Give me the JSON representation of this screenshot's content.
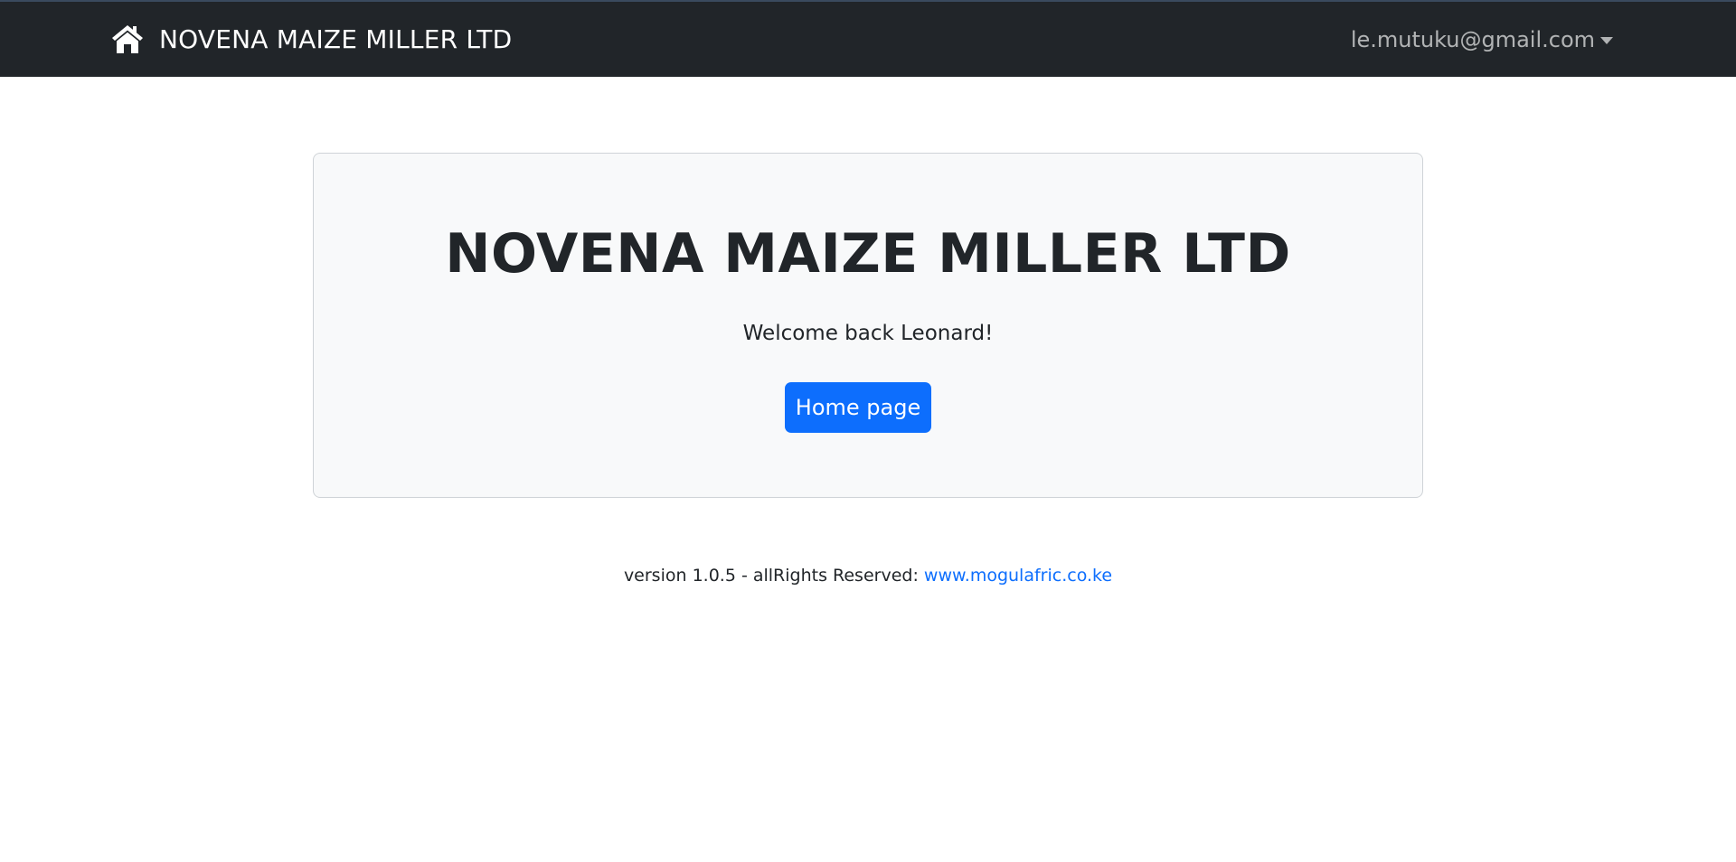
{
  "navbar": {
    "brand_icon": "home-icon",
    "brand_text": "NOVENA MAIZE MILLER LTD",
    "user_email": "le.mutuku@gmail.com",
    "user_menu_icon": "caret-down-icon",
    "background_color": "#212529"
  },
  "hero": {
    "title": "NOVENA MAIZE MILLER LTD",
    "welcome_text": "Welcome back Leonard!",
    "button_label": "Home page",
    "button_color": "#0d6efd"
  },
  "footer": {
    "text": "version 1.0.5 - allRights Reserved:",
    "link_text": "www.mogulafric.co.ke"
  }
}
